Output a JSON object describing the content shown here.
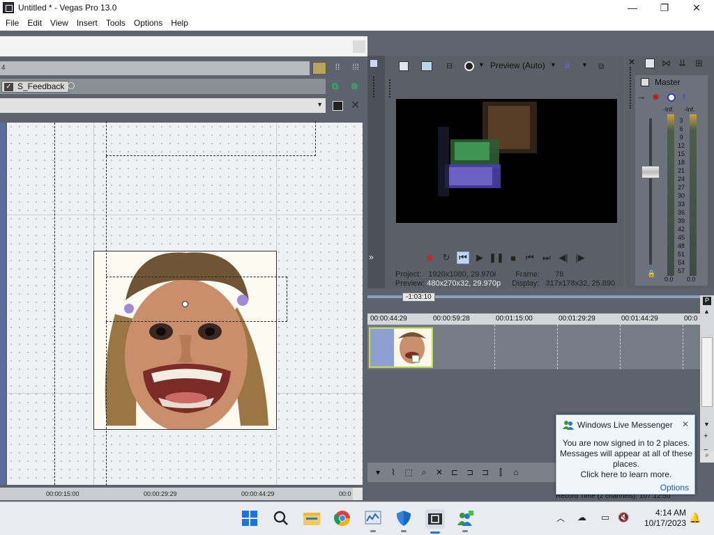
{
  "window": {
    "title": "Untitled * - Vegas Pro 13.0",
    "minimize": "—",
    "maximize": "❐",
    "close": "✕"
  },
  "menu": [
    "File",
    "Edit",
    "View",
    "Insert",
    "Tools",
    "Options",
    "Help"
  ],
  "fx_window": {
    "row_label": "4",
    "chain_plugin": "S_Feedback",
    "ruler_labels": [
      "00:00:15:00",
      "00:00:29:29",
      "00:00:44:29",
      "00:0"
    ]
  },
  "preview": {
    "mode_label": "Preview (Auto)",
    "project_label": "Project:",
    "project_value": "1920x1080, 29.970i",
    "frame_label": "Frame:",
    "frame_value": "78",
    "preview_label": "Preview:",
    "preview_value": "480x270x32, 29.970p",
    "display_label": "Display:",
    "display_value": "317x178x32, 25.890"
  },
  "master": {
    "label": "Master",
    "inf_left": "-Inf.",
    "inf_right": "-Inf.",
    "scale": [
      "3",
      "6",
      "9",
      "12",
      "15",
      "18",
      "21",
      "24",
      "27",
      "30",
      "33",
      "36",
      "39",
      "42",
      "45",
      "48",
      "51",
      "54",
      "57"
    ],
    "bottom_left": "0.0",
    "bottom_right": "0.0"
  },
  "timeline": {
    "cursor_time": "-1:03:10",
    "ruler": [
      "00:00:44:29",
      "00:00:59:28",
      "00:01:15:00",
      "00:01:29:29",
      "00:01:44:29",
      "00:0"
    ],
    "record_time": "Record Time (2 channels): 107:12:50"
  },
  "notification": {
    "title": "Windows Live Messenger",
    "close": "✕",
    "line1": "You are now signed in to 2 places.",
    "line2": "Messages will appear at all of these",
    "line3": "places.",
    "line4": "Click here to learn more.",
    "options": "Options"
  },
  "taskbar": {
    "time": "4:14 AM",
    "date": "10/17/2023"
  }
}
